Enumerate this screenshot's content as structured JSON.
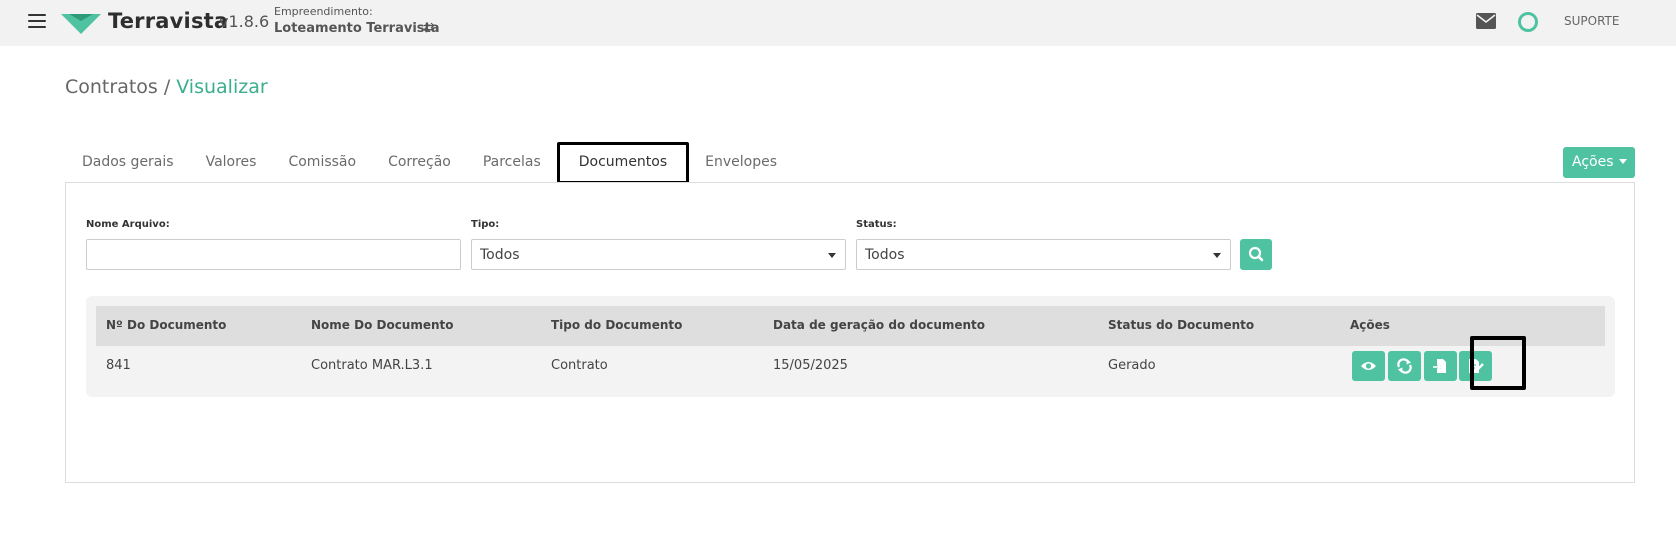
{
  "header": {
    "brand": "Terravista",
    "version": "v1.8.6",
    "empreendimento_label": "Empreendimento:",
    "empreendimento_name": "Loteamento Terravista",
    "swap_icon": "⇄",
    "support_label": "SUPORTE",
    "brand_color": "#4fc3a1"
  },
  "breadcrumb": {
    "root": "Contratos",
    "separator": "/",
    "current": "Visualizar"
  },
  "tabs": [
    {
      "label": "Dados gerais",
      "active": false
    },
    {
      "label": "Valores",
      "active": false
    },
    {
      "label": "Comissão",
      "active": false
    },
    {
      "label": "Correção",
      "active": false
    },
    {
      "label": "Parcelas",
      "active": false
    },
    {
      "label": "Documentos",
      "active": true
    },
    {
      "label": "Envelopes",
      "active": false
    }
  ],
  "actions_button": {
    "label": "Ações"
  },
  "filters": {
    "nome_arquivo": {
      "label": "Nome Arquivo:",
      "value": ""
    },
    "tipo": {
      "label": "Tipo:",
      "value": "Todos"
    },
    "status": {
      "label": "Status:",
      "value": "Todos"
    }
  },
  "table": {
    "columns": [
      "Nº Do Documento",
      "Nome Do Documento",
      "Tipo do Documento",
      "Data de geração do documento",
      "Status do Documento",
      "Ações"
    ],
    "rows": [
      {
        "numero": "841",
        "nome": "Contrato MAR.L3.1",
        "tipo": "Contrato",
        "data": "15/05/2025",
        "status": "Gerado"
      }
    ],
    "row_actions": [
      "eye-icon",
      "refresh-icon",
      "file-export-icon",
      "file-sign-icon"
    ]
  }
}
